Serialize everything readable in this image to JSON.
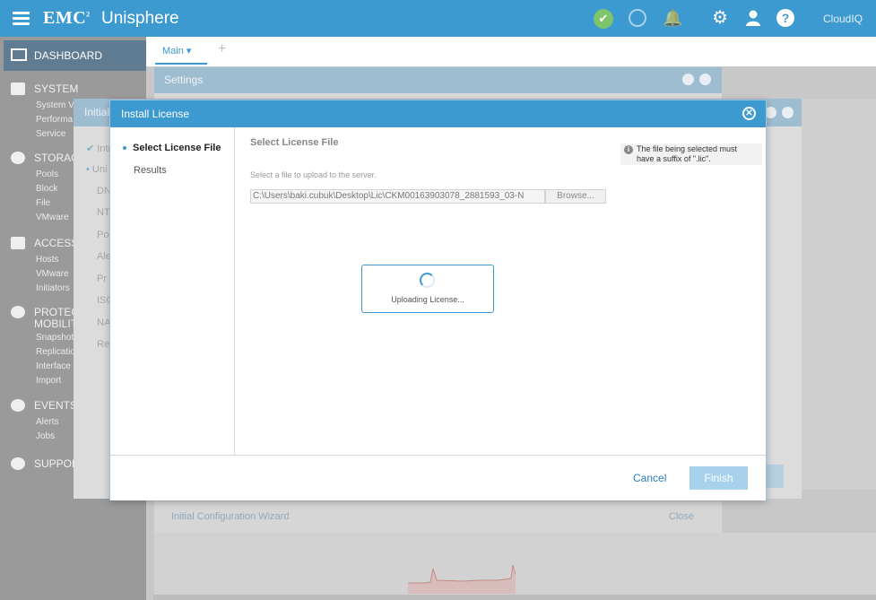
{
  "topbar": {
    "brand": "EMC",
    "brand_sup": "2",
    "app_name": "Unisphere",
    "cloudiq_label": "CloudIQ",
    "icons": [
      "menu-icon",
      "health-ok-icon",
      "gauge-icon",
      "bell-icon",
      "gear-icon",
      "user-icon",
      "help-icon"
    ]
  },
  "sidebar": {
    "dashboard": "DASHBOARD",
    "sections": [
      {
        "title": "SYSTEM",
        "items": [
          "System V",
          "Performa",
          "Service"
        ]
      },
      {
        "title": "STORAG",
        "items": [
          "Pools",
          "Block",
          "File",
          "VMware"
        ]
      },
      {
        "title": "ACCESS",
        "items": [
          "Hosts",
          "VMware",
          "Initiators"
        ]
      },
      {
        "title": "PROTEC",
        "title2": "MOBILIT",
        "items": [
          "Snapshot",
          "Replicatio",
          "Interface",
          "Import"
        ]
      },
      {
        "title": "EVENTS",
        "items": [
          "Alerts",
          "Jobs"
        ]
      },
      {
        "title": "SUPPOR",
        "items": []
      }
    ]
  },
  "tabs": {
    "main": "Main",
    "main_caret": "▾",
    "add": "+"
  },
  "settings_dialog": {
    "title": "Settings",
    "footer_link": "Initial Configuration Wizard",
    "close_link": "Close"
  },
  "wizard_dialog": {
    "title": "Initial",
    "steps": [
      "Intr",
      "Uni",
      "DN",
      "NT",
      "Po",
      "Ale",
      "Pr",
      "ISC",
      "NA",
      "Re"
    ]
  },
  "install_license": {
    "title": "Install License",
    "nav": [
      "Select License File",
      "Results"
    ],
    "content_title": "Select License File",
    "info_line1": "The file being selected must",
    "info_line2": "have a suffix of \".lic\".",
    "hint": "Select a file to upload to the server.",
    "file_path": "C:\\Users\\baki.cubuk\\Desktop\\Lic\\CKM00163903078_2881593_03-N",
    "browse": "Browse...",
    "uploading": "Uploading License...",
    "cancel": "Cancel",
    "finish": "Finish"
  },
  "colors": {
    "accent": "#3d9ad1",
    "link": "#2a7db8",
    "finish_disabled": "#a8d1ec",
    "ok_green": "#7ec46b"
  }
}
